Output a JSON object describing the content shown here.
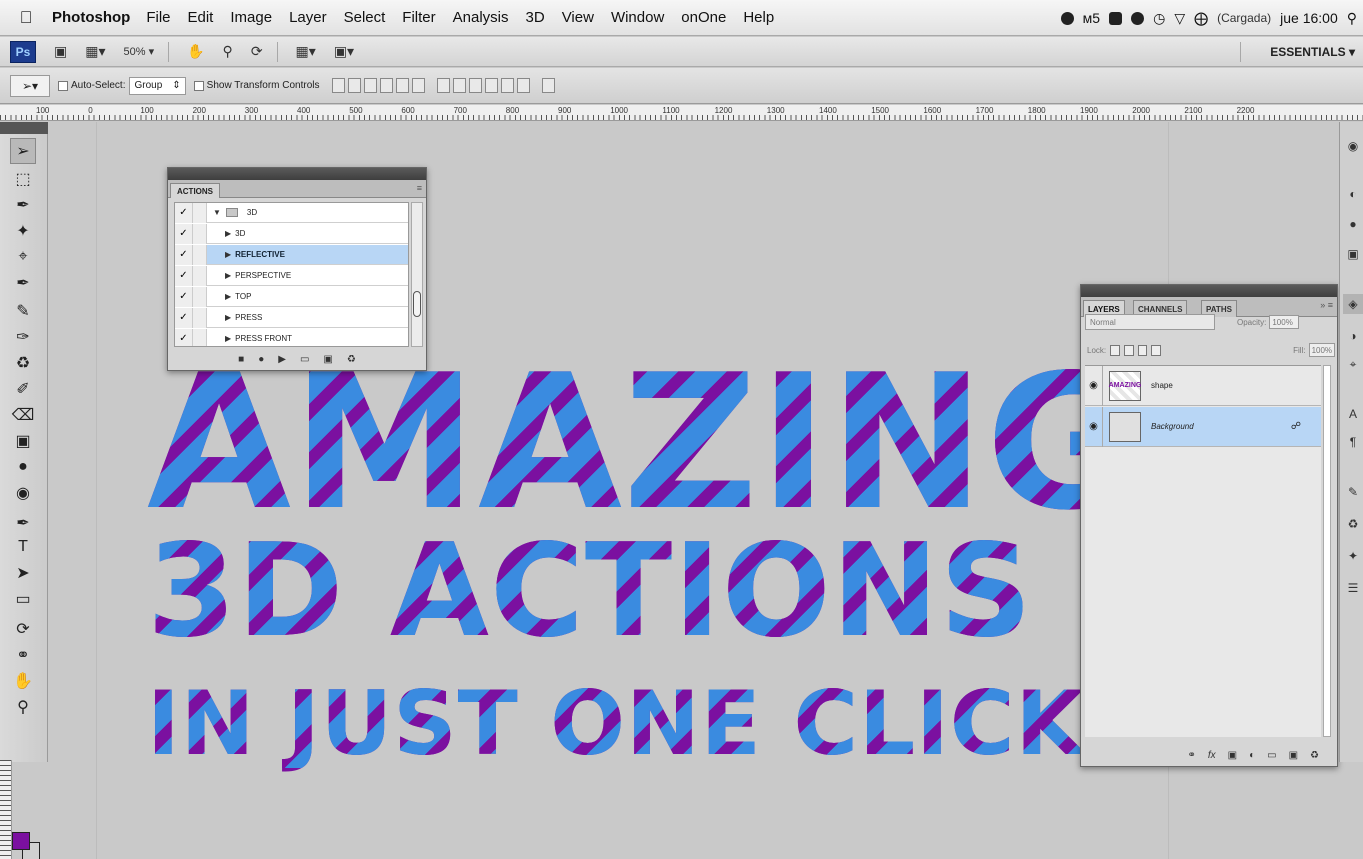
{
  "menubar": {
    "app": "Photoshop",
    "items": [
      "File",
      "Edit",
      "Image",
      "Layer",
      "Select",
      "Filter",
      "Analysis",
      "3D",
      "View",
      "Window",
      "onOne",
      "Help"
    ],
    "status_text": "(Cargada)",
    "clock": "jue 16:00"
  },
  "appbar": {
    "logo": "Ps",
    "zoom": "50%",
    "workspace": "ESSENTIALS"
  },
  "options": {
    "auto_select": "Auto-Select:",
    "auto_select_value": "Group",
    "transform": "Show Transform Controls"
  },
  "ruler": {
    "labels": [
      "100",
      "0",
      "100",
      "200",
      "300",
      "400",
      "500",
      "600",
      "700",
      "800",
      "900",
      "1000",
      "1100",
      "1200",
      "1300",
      "1400",
      "1500",
      "1600",
      "1700",
      "1800",
      "1900",
      "2000",
      "2100",
      "2200"
    ]
  },
  "canvas": {
    "line1": "AMAZING",
    "line2": "3D ACTIONS",
    "line3": "IN JUST ONE CLICK"
  },
  "actions_panel": {
    "title": "ACTIONS",
    "set_name": "3D",
    "items": [
      "3D",
      "REFLECTIVE",
      "PERSPECTIVE",
      "TOP",
      "PRESS",
      "PRESS FRONT"
    ],
    "selected": "REFLECTIVE"
  },
  "layers_panel": {
    "tabs": [
      "LAYERS",
      "CHANNELS",
      "PATHS"
    ],
    "blend_mode": "Normal",
    "opacity_label": "Opacity:",
    "opacity_value": "100%",
    "lock_label": "Lock:",
    "fill_label": "Fill:",
    "fill_value": "100%",
    "layers": [
      {
        "name": "shape",
        "selected": false
      },
      {
        "name": "Background",
        "selected": true
      }
    ]
  },
  "colors": {
    "foreground": "#7b10a0",
    "text_purple": "#7b10a0",
    "stripe_blue": "#3a8be0",
    "selection_blue": "#b8d6f5"
  }
}
